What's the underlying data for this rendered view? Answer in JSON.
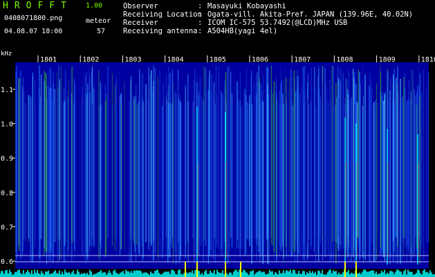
{
  "header": {
    "title": "HROFFT",
    "version": "1.00",
    "file_name": "0408071800.png",
    "datetime": "04.08.07 18:00",
    "meteor_label": "meteor",
    "meteor_count": "57"
  },
  "info": [
    {
      "key": "Observer",
      "value": "Masayuki Kobayashi"
    },
    {
      "key": "Receiving Location",
      "value": "Ogata-vill. Akita-Pref. JAPAN (139.96E, 40.02N)"
    },
    {
      "key": "Receiver",
      "value": "ICOM IC-575 53.7492(@LCD)MHz USB"
    },
    {
      "key": "Receiving antenna",
      "value": "A504HB(yagi 4el)"
    }
  ],
  "spectrogram": {
    "unit_label": "kHz",
    "y_labels": [
      "1.1",
      "1.0",
      "0.9",
      "0.8",
      "0.7",
      "0.6"
    ],
    "time_labels": [
      "1801",
      "1802",
      "1803",
      "1804",
      "1805",
      "1806",
      "1807",
      "1808",
      "1809",
      "1810"
    ],
    "colors": {
      "background": "#0000a0",
      "accent": "#7CFC00",
      "signal": "#00ffff",
      "peak": "#ffff00"
    }
  }
}
